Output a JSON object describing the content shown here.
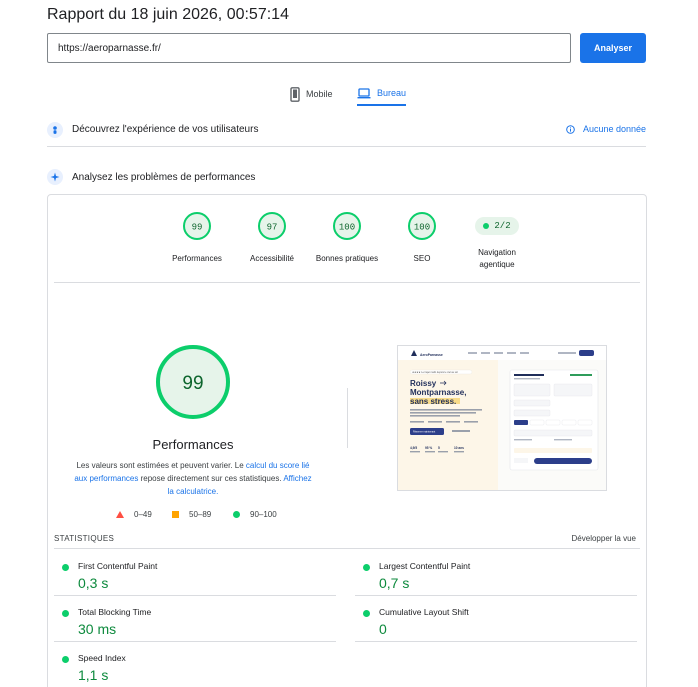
{
  "report": {
    "title": "Rapport du 18 juin 2026, 00:57:14"
  },
  "search": {
    "url": "https://aeroparnasse.fr/",
    "analyze_label": "Analyser"
  },
  "devices": {
    "mobile": "Mobile",
    "desktop": "Bureau"
  },
  "experience": {
    "title": "Découvrez l'expérience de vos utilisateurs",
    "no_data": "Aucune donnée"
  },
  "perf_section": {
    "title": "Analysez les problèmes de performances"
  },
  "gauges": [
    {
      "label": "Performances",
      "score": "99"
    },
    {
      "label": "Accessibilité",
      "score": "97"
    },
    {
      "label": "Bonnes pratiques",
      "score": "100"
    },
    {
      "label": "SEO",
      "score": "100"
    }
  ],
  "agentic": {
    "score": "2/2",
    "label_line1": "Navigation",
    "label_line2": "agentique"
  },
  "main_gauge": {
    "score": "99",
    "label": "Performances",
    "desc_before": "Les valeurs sont estimées et peuvent varier. Le ",
    "desc_link1": "calcul du score lié aux performances",
    "desc_middle": " repose directement sur ces statistiques. ",
    "desc_link2": "Affichez la calculatrice."
  },
  "legend": {
    "poor": "0–49",
    "average": "50–89",
    "good": "90–100"
  },
  "preview": {
    "brand": "AeroParnasse",
    "badge": "★★★★ Le trajet malin depuis le ciel au sol",
    "headline1": "Roissy",
    "headline2": "Montparnasse,",
    "headline3": "sans stress.",
    "cta": "Réserver maintenant",
    "stat1": "4,9/5",
    "stat2": "95 %",
    "stat3": "5",
    "stat4": "10 ans"
  },
  "stats": {
    "title": "STATISTIQUES",
    "expand": "Développer la vue",
    "metrics": [
      {
        "name": "First Contentful Paint",
        "value": "0,3 s"
      },
      {
        "name": "Largest Contentful Paint",
        "value": "0,7 s"
      },
      {
        "name": "Total Blocking Time",
        "value": "30 ms"
      },
      {
        "name": "Cumulative Layout Shift",
        "value": "0"
      },
      {
        "name": "Speed Index",
        "value": "1,1 s"
      }
    ]
  },
  "colors": {
    "good": "#0cce6b",
    "good_text": "#0d8a3d",
    "accent": "#1a73e8",
    "poor": "#ff4e42",
    "average": "#ffa400"
  }
}
